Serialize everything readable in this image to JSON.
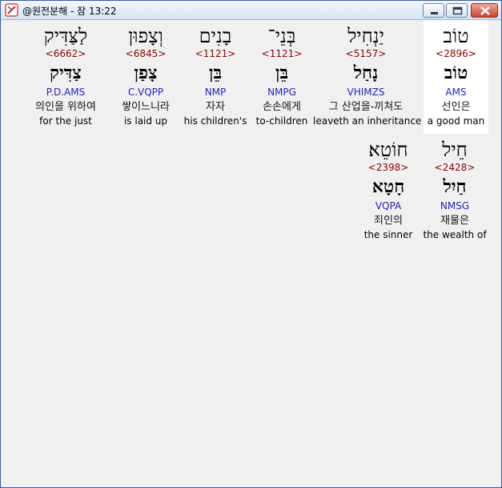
{
  "window": {
    "title": "@원전분해 - 잠 13:22"
  },
  "rows": [
    {
      "words": [
        {
          "hebrew": "טוֹב",
          "strong": "<2896>",
          "lemma": "טוֹב",
          "morph": "AMS",
          "korean": "선인은",
          "english": "a good man",
          "highlighted": true
        },
        {
          "hebrew": "יַנְחִיל",
          "strong": "<5157>",
          "lemma": "נָחַל",
          "morph": "VHIMZS",
          "korean": "그 산업을-끼쳐도",
          "english": "leaveth an inheritance",
          "highlighted": false
        },
        {
          "hebrew": "בְּנֵי־",
          "strong": "<1121>",
          "lemma": "בֵּן",
          "morph": "NMPG",
          "korean": "손손에게",
          "english": "to-children",
          "highlighted": false
        },
        {
          "hebrew": "בָנִים",
          "strong": "<1121>",
          "lemma": "בֵּן",
          "morph": "NMP",
          "korean": "자자",
          "english": "his children's",
          "highlighted": false
        },
        {
          "hebrew": "וְצָפוּן",
          "strong": "<6845>",
          "lemma": "צָפַן",
          "morph": "C.VQPP",
          "korean": "쌓이느니라",
          "english": "is laid up",
          "highlighted": false
        },
        {
          "hebrew": "לַצַּדִּיק",
          "strong": "<6662>",
          "lemma": "צַדִּיק",
          "morph": "P.D.AMS",
          "korean": "의인을 위하여",
          "english": "for the just",
          "highlighted": false
        }
      ]
    },
    {
      "words": [
        {
          "hebrew": "חֵיל",
          "strong": "<2428>",
          "lemma": "חַיִל",
          "morph": "NMSG",
          "korean": "재물은",
          "english": "the wealth of",
          "highlighted": false
        },
        {
          "hebrew": "חוֹטֵא׃",
          "strong": "<2398>",
          "lemma": "חָטָא",
          "morph": "VQPA",
          "korean": "죄인의",
          "english": "the sinner",
          "highlighted": false
        }
      ]
    }
  ]
}
